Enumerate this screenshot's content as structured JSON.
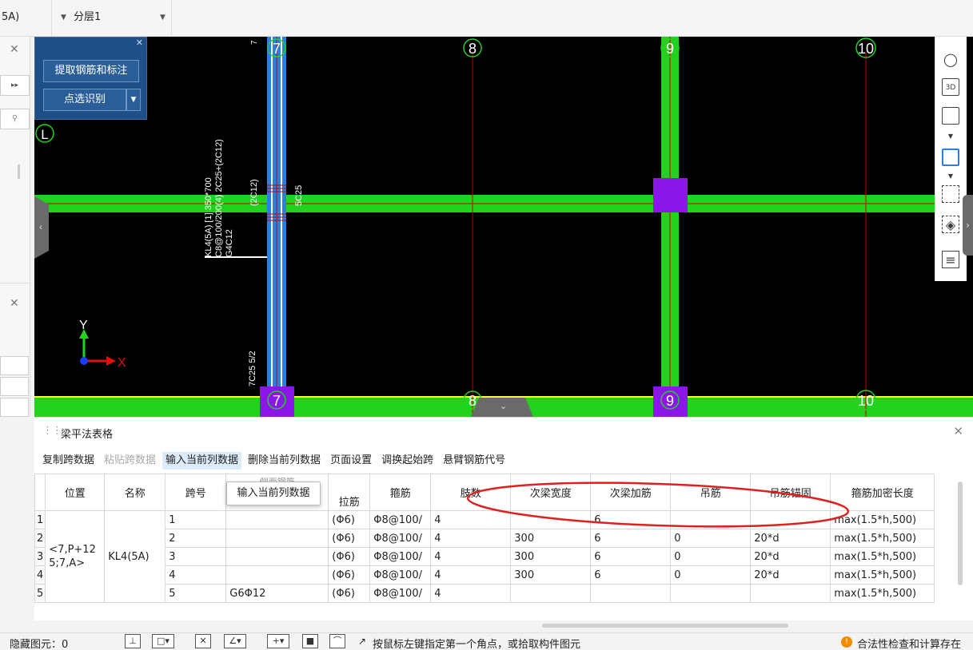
{
  "topbar": {
    "component_name": "5A)",
    "layer_select": "分层1"
  },
  "float_panel": {
    "extract_button": "提取钢筋和标注",
    "point_select_button": "点选识别"
  },
  "canvas": {
    "axis_top": [
      "7",
      "8",
      "9",
      "10"
    ],
    "axis_bottom": [
      "7",
      "8",
      "9",
      "10"
    ],
    "axis_left": "L",
    "beam_annotation_lines": [
      "KL4(5A) [1] 350*700",
      "C8@100/200(4) 2C25+(2C12)",
      "G4C12"
    ],
    "beam_side_label": "(2C12)",
    "beam_right_label": "5C25",
    "beam_bottom_label": "7C25 5/2",
    "top_clip_label": "7",
    "coord_y": "Y",
    "coord_x": "X"
  },
  "table_panel": {
    "title": "梁平法表格",
    "toolbar": {
      "copy": "复制跨数据",
      "paste": "粘贴跨数据",
      "input_col": "输入当前列数据",
      "delete_col": "删除当前列数据",
      "page_setup": "页面设置",
      "swap_start": "调换起始跨",
      "cantilever": "悬臂钢筋代号"
    },
    "tooltip": "输入当前列数据",
    "headers": {
      "position": "位置",
      "name": "名称",
      "span": "跨号",
      "side_rebar": "侧面钢筋",
      "tie": "拉筋",
      "stirrup": "箍筋",
      "legs": "肢数",
      "sec_width": "次梁宽度",
      "sec_rebar": "次梁加筋",
      "hanger": "吊筋",
      "hanger_anchor": "吊筋锚固",
      "dense_len": "箍筋加密长度"
    },
    "merged": {
      "position": "<7,P+125;7,A>",
      "name": "KL4(5A)"
    },
    "rows": [
      {
        "rn": "1",
        "span": "1",
        "side": "",
        "tie": "(Φ6)",
        "stirrup": "Φ8@100/",
        "legs": "4",
        "sec_width": "",
        "sec_rebar": "6",
        "hanger": "",
        "anchor": "",
        "dense": "max(1.5*h,500)"
      },
      {
        "rn": "2",
        "span": "2",
        "side": "",
        "tie": "(Φ6)",
        "stirrup": "Φ8@100/",
        "legs": "4",
        "sec_width": "300",
        "sec_rebar": "6",
        "hanger": "0",
        "anchor": "20*d",
        "dense": "max(1.5*h,500)"
      },
      {
        "rn": "3",
        "span": "3",
        "side": "",
        "tie": "(Φ6)",
        "stirrup": "Φ8@100/",
        "legs": "4",
        "sec_width": "300",
        "sec_rebar": "6",
        "hanger": "0",
        "anchor": "20*d",
        "dense": "max(1.5*h,500)"
      },
      {
        "rn": "4",
        "span": "4",
        "side": "",
        "tie": "(Φ6)",
        "stirrup": "Φ8@100/",
        "legs": "4",
        "sec_width": "300",
        "sec_rebar": "6",
        "hanger": "0",
        "anchor": "20*d",
        "dense": "max(1.5*h,500)"
      },
      {
        "rn": "5",
        "span": "5",
        "side": "G6Φ12",
        "tie": "(Φ6)",
        "stirrup": "Φ8@100/",
        "legs": "4",
        "sec_width": "",
        "sec_rebar": "",
        "hanger": "",
        "anchor": "",
        "dense": "max(1.5*h,500)"
      }
    ]
  },
  "statusbar": {
    "hidden": "隐藏图元：0",
    "hint": "按鼠标左键指定第一个角点，或拾取构件图元",
    "legality": "合法性检查和计算存在"
  },
  "colors": {
    "beam_green": "#22d21e",
    "column_purple": "#8a16e8",
    "column_blue": "#2a7fe0",
    "axis_red": "#c80000",
    "panel_blue": "#1e4f86",
    "highlight_ellipse": "#e02020"
  }
}
